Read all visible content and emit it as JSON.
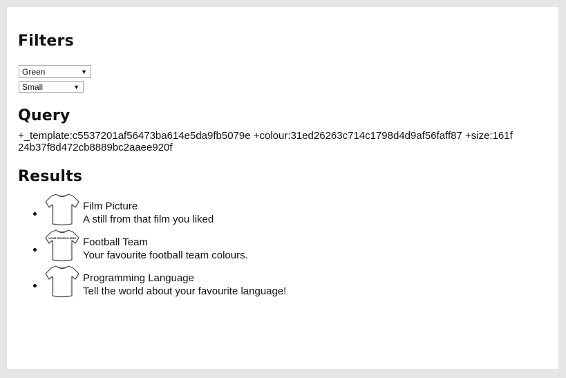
{
  "filters": {
    "title": "Filters",
    "colour_selected": "Green",
    "size_selected": "Small"
  },
  "query": {
    "title": "Query",
    "text": "+_template:c5537201af56473ba614e5da9fb5079e +colour:31ed26263c714c1798d4d9af56faff87 +size:161f24b37f8d472cb8889bc2aaee920f"
  },
  "results": {
    "title": "Results",
    "items": [
      {
        "title": "Film Picture",
        "description": "A still from that film you liked",
        "icon": "tshirt-icon"
      },
      {
        "title": "Football Team",
        "description": "Your favourite football team colours.",
        "icon": "tshirt-with-text-icon",
        "shirt_text": "YOUR DESIGN HERE"
      },
      {
        "title": "Programming Language",
        "description": "Tell the world about your favourite language!",
        "icon": "tshirt-icon"
      }
    ]
  }
}
